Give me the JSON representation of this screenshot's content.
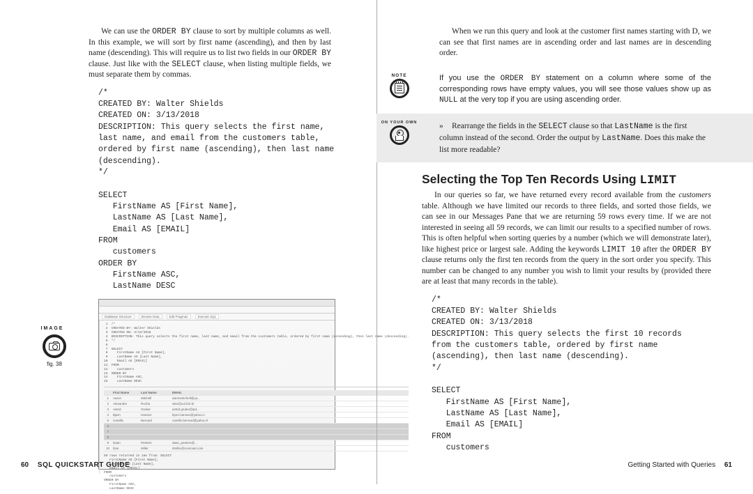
{
  "left": {
    "para1_a": "We can use the ",
    "para1_b": " clause to sort by multiple columns as well. In this example, we will sort by first name (ascending), and then by last name (descending). This will require us to list two fields in our ",
    "para1_c": " clause. Just like with the ",
    "para1_d": " clause, when listing multiple fields, we must separate them by commas.",
    "code_order_by": "ORDER BY",
    "code_select": "SELECT",
    "sql1": "/*\nCREATED BY: Walter Shields\nCREATED ON: 3/13/2018\nDESCRIPTION: This query selects the first name,\nlast name, and email from the customers table,\nordered by first name (ascending), then last name\n(descending).\n*/\n\nSELECT\n   FirstName AS [First Name],\n   LastName AS [Last Name],\n   Email AS [EMAIL]\nFROM\n   customers\nORDER BY\n   FirstName ASC,\n   LastName DESC",
    "image_label": "IMAGE",
    "fig_label": "fig. 38",
    "screenshot": {
      "tabs": [
        "Database Structure",
        "Browse Data",
        "Edit Pragmas",
        "Execute SQL"
      ],
      "sql": " 1  /*\n 2  CREATED BY: Walter Shields\n 3  CREATED ON: 3/13/2018\n 4  DESCRIPTION: This query selects the first name, last name, and email from the customers table, ordered by first name (ascending), then last name (descending).\n 5  */\n 6  \n 7  SELECT\n 8     FirstName AS [First Name],\n 9     LastName AS [Last Name],\n10     Email AS [EMAIL]\n11  FROM\n12     customers\n13  ORDER BY\n14     FirstName ASC,\n15     LastName DESC",
      "headers": [
        "",
        "First Name",
        "Last Name",
        "EMAIL"
      ],
      "rows": [
        [
          "1",
          "Aaron",
          "Mitchell",
          "aaronmitchell@ya..."
        ],
        [
          "2",
          "Alexandre",
          "Rocha",
          "alex@uol.bm.br"
        ],
        [
          "3",
          "Astrid",
          "Gruber",
          "astrid.gruber@pd..."
        ],
        [
          "4",
          "Bjørn",
          "Hansen",
          "bjorn.hansen@yahoo.n"
        ],
        [
          "5",
          "Camille",
          "Bernard",
          "camille.bernard@yahoo.fr"
        ],
        [
          "6",
          "",
          "",
          ""
        ],
        [
          "7",
          "",
          "",
          ""
        ],
        [
          "8",
          "",
          "",
          ""
        ],
        [
          "9",
          "Daan",
          "Peeters",
          "daan_peeters@..."
        ],
        [
          "10",
          "Dan",
          "Miller",
          "dmiller@comcast.com"
        ]
      ],
      "msg": "59 rows returned in 1ms from: SELECT\n   FirstName AS [First Name],\n   LastName AS [Last Name],\n   Email AS [EMAIL]\nFROM\n   customers\nORDER BY\n   FirstName ASC,\n   LastName DESC"
    },
    "footer_page": "60",
    "footer_title": "SQL QUICKSTART GUIDE"
  },
  "right": {
    "para1": "When we run this query and look at the customer first names starting with D, we can see that first names are in ascending order and last names are in descending order.",
    "note_label": "NOTE",
    "note_a": "If you use the ",
    "note_b": " statement on a column where some of the corresponding rows have empty values, you will see those values show up as ",
    "note_c": " at the very top if you are using ascending order.",
    "code_null": "NULL",
    "oyo_label": "ON YOUR OWN",
    "oyo_a": "Rearrange the fields in the ",
    "oyo_b": " clause so that ",
    "oyo_c": " is the first column instead of the second. Order the output by ",
    "oyo_d": ". Does this make the list more readable?",
    "code_lastname": "LastName",
    "heading_a": "Selecting the Top Ten Records Using ",
    "heading_code": "LIMIT",
    "para2_a": "In our queries so far, we have returned every record available from the ",
    "para2_b": " table. Although we have limited our records to three fields, and sorted those fields, we can see in our Messages Pane that we are returning 59 rows every time. If we are not interested in seeing all 59 records, we can limit our results to a specified number of rows. This is often helpful when sorting queries by a number (which we will demonstrate later), like highest price or largest sale. Adding the keywords ",
    "para2_c": " after the ",
    "para2_d": " clause returns only the first ten records from the query in the sort order you specify. This number can be changed to any number you wish to limit your results by (provided there are at least that many records in the table).",
    "customers_italic": "customers",
    "code_limit10": "LIMIT 10",
    "sql2": "/*\nCREATED BY: Walter Shields\nCREATED ON: 3/13/2018\nDESCRIPTION: This query selects the first 10 records\nfrom the customers table, ordered by first name\n(ascending), then last name (descending).\n*/\n\nSELECT\n   FirstName AS [First Name],\n   LastName AS [Last Name],\n   Email AS [EMAIL]\nFROM\n   customers",
    "footer_title": "Getting Started with Queries",
    "footer_page": "61"
  }
}
